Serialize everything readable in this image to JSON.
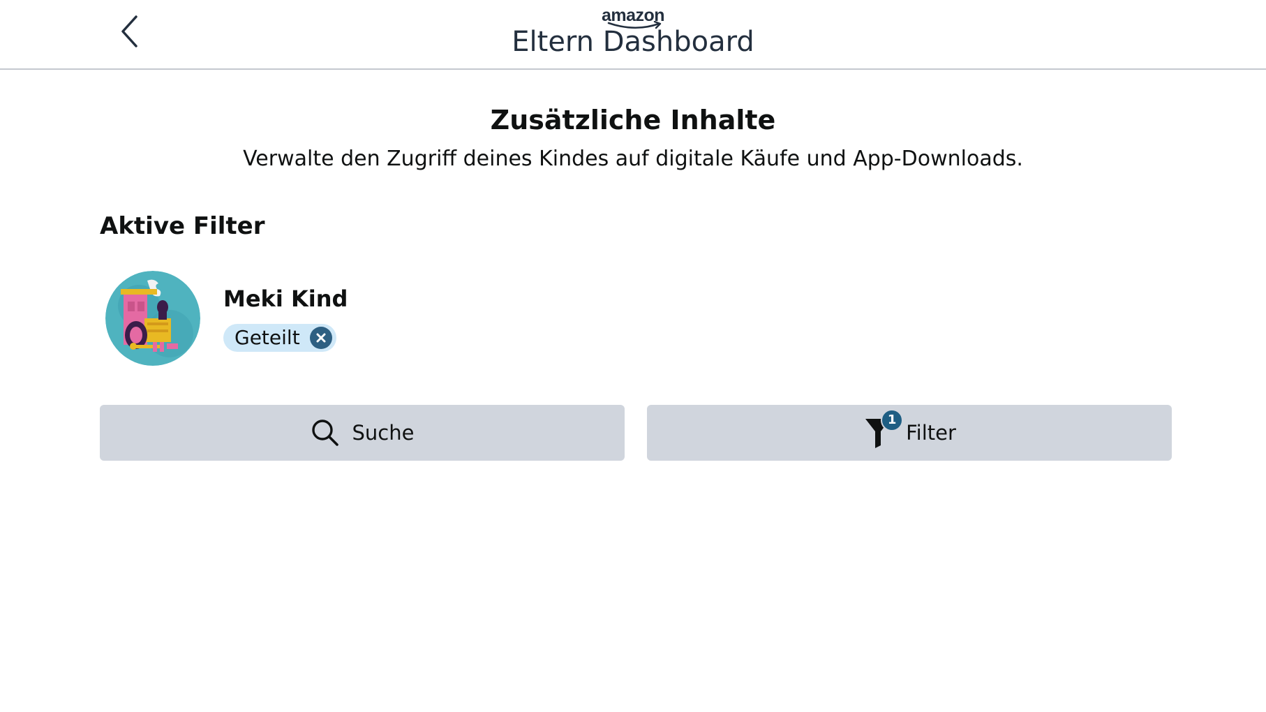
{
  "header": {
    "brand_logo": "amazon",
    "title": "Eltern Dashboard",
    "back_icon": "chevron-left-icon"
  },
  "page": {
    "title": "Zusätzliche Inhalte",
    "subtitle": "Verwalte den Zugriff deines Kindes auf digitale Käufe und App-Downloads."
  },
  "active_filters": {
    "heading": "Aktive Filter",
    "profile": {
      "name": "Meki Kind",
      "avatar_icon": "train-avatar-icon",
      "chip_label": "Geteilt",
      "chip_close_icon": "close-icon"
    }
  },
  "actions": {
    "search": {
      "label": "Suche",
      "icon": "search-icon"
    },
    "filter": {
      "label": "Filter",
      "icon": "filter-icon",
      "badge_count": "1"
    }
  },
  "colors": {
    "button_bg": "#d0d5dd",
    "chip_bg": "#cfe8f8",
    "chip_close_bg": "#2d5f82",
    "badge_bg": "#1e5e83",
    "avatar_bg": "#4fb3bf",
    "text": "#0f1111"
  }
}
